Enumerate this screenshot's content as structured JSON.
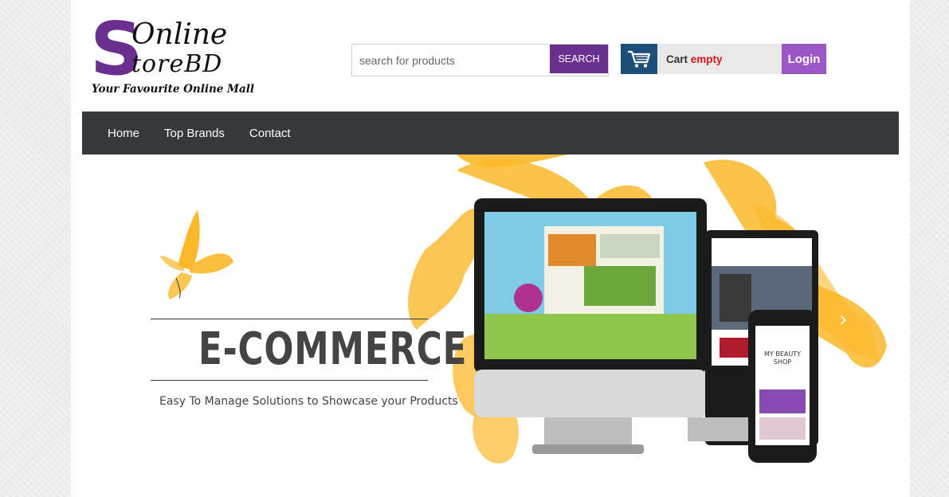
{
  "logo": {
    "letter_s": "S",
    "line1": "Online",
    "line2": "tore",
    "line2_suffix": "BD",
    "tagline": "Your Favourite Online Mall"
  },
  "search": {
    "placeholder": "search for products",
    "button_label": "SEARCH"
  },
  "cart": {
    "label": "Cart",
    "status": "empty",
    "icon": "shopping-cart-icon"
  },
  "login": {
    "label": "Login"
  },
  "nav": {
    "items": [
      {
        "label": "Home"
      },
      {
        "label": "Top Brands"
      },
      {
        "label": "Contact"
      }
    ]
  },
  "banner": {
    "headline": "E-COMMERCE",
    "subtitle": "Easy To Manage Solutions to Showcase your Products",
    "phone_title": "MY BEAUTY",
    "phone_subtitle": "SHOP",
    "next_icon": "chevron-right-icon"
  },
  "colors": {
    "brand_purple": "#6b2f8f",
    "login_purple": "#9b57c6",
    "cart_blue": "#1e4f78",
    "nav_dark": "#35393c",
    "accent_orange": "#fbb82a"
  }
}
